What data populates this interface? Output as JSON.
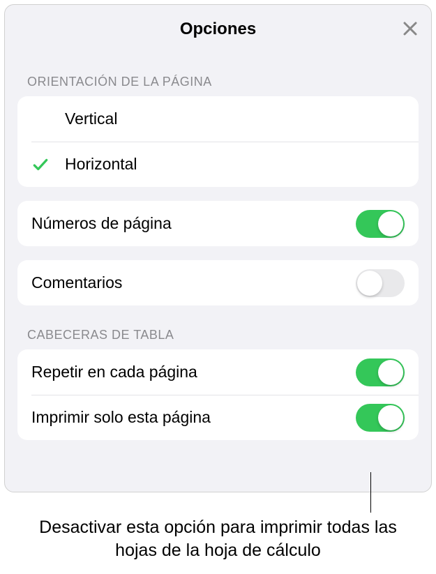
{
  "header": {
    "title": "Opciones"
  },
  "orientation": {
    "header": "ORIENTACIÓN DE LA PÁGINA",
    "vertical": "Vertical",
    "horizontal": "Horizontal",
    "selected": "horizontal"
  },
  "pageNumbers": {
    "label": "Números de página",
    "on": true
  },
  "comments": {
    "label": "Comentarios",
    "on": false
  },
  "tableHeaders": {
    "header": "CABECERAS DE TABLA",
    "repeat": {
      "label": "Repetir en cada página",
      "on": true
    },
    "printOnly": {
      "label": "Imprimir solo esta página",
      "on": true
    }
  },
  "callout": "Desactivar esta opción para imprimir todas las hojas de la hoja de cálculo",
  "colors": {
    "accent": "#34c759"
  }
}
